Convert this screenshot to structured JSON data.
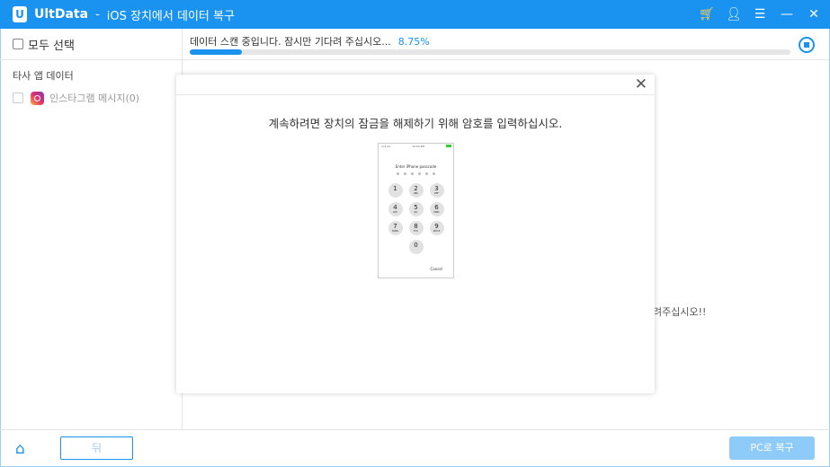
{
  "titlebar": {
    "app_name": "UltData",
    "separator": "-",
    "subtitle": "iOS 장치에서 데이터 복구",
    "icons": [
      "cart-icon",
      "user-icon",
      "menu-icon",
      "minimize-icon",
      "close-icon"
    ]
  },
  "sidebar": {
    "select_all": "모두 선택",
    "category": "타사 앱 데이터",
    "items": [
      {
        "label": "인스타그램 메시지(0)",
        "icon": "instagram-icon"
      }
    ]
  },
  "scan": {
    "status": "데이터 스캔 중입니다. 잠시만 기다려 주십시오...",
    "percent_text": "8.75%",
    "progress": 8.75
  },
  "background_text": "려주십시오!!",
  "modal": {
    "message": "계속하려면 장치의 잠금을 해제하기 위해 암호를 입력하십시오.",
    "phone": {
      "status_left": "·ııl 9:41",
      "status_center": "12:00 PM",
      "prompt": "Enter iPhone passcode",
      "keys": [
        {
          "n": "1",
          "l": ""
        },
        {
          "n": "2",
          "l": "ABC"
        },
        {
          "n": "3",
          "l": "DEF"
        },
        {
          "n": "4",
          "l": "GHI"
        },
        {
          "n": "5",
          "l": "JKL"
        },
        {
          "n": "6",
          "l": "MNO"
        },
        {
          "n": "7",
          "l": "PQRS"
        },
        {
          "n": "8",
          "l": "TUV"
        },
        {
          "n": "9",
          "l": "WXYZ"
        },
        {
          "n": "0",
          "l": ""
        }
      ],
      "cancel": "Cancel"
    }
  },
  "footer": {
    "back": "뒤",
    "restore": "PC로 복구"
  },
  "colors": {
    "accent": "#1a93f0",
    "restore_disabled": "#8ecbf8"
  }
}
